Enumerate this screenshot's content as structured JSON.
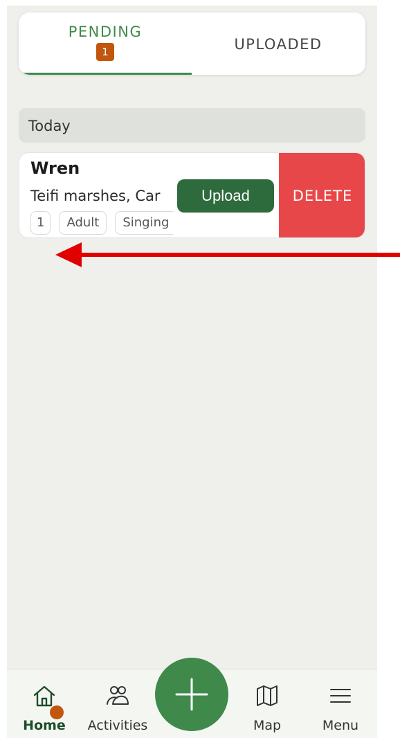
{
  "tabs": {
    "pending_label": "PENDING",
    "pending_count": "1",
    "uploaded_label": "UPLOADED"
  },
  "section": {
    "title": "Today"
  },
  "record": {
    "species": "Wren",
    "location": "Teifi marshes, Car",
    "chips": [
      "1",
      "Adult",
      "Singing"
    ],
    "upload_label": "Upload",
    "delete_label": "DELETE"
  },
  "annotation": {
    "arrow_color": "#e00000",
    "direction": "left"
  },
  "nav": {
    "home_label": "Home",
    "activities_label": "Activities",
    "map_label": "Map",
    "menu_label": "Menu",
    "icons": [
      "home-icon",
      "activities-icon",
      "plus-icon",
      "map-icon",
      "menu-icon"
    ]
  },
  "colors": {
    "accent": "#3f8a4b",
    "dark_green": "#2e6b3c",
    "badge": "#c2560e",
    "delete": "#e8474a"
  }
}
